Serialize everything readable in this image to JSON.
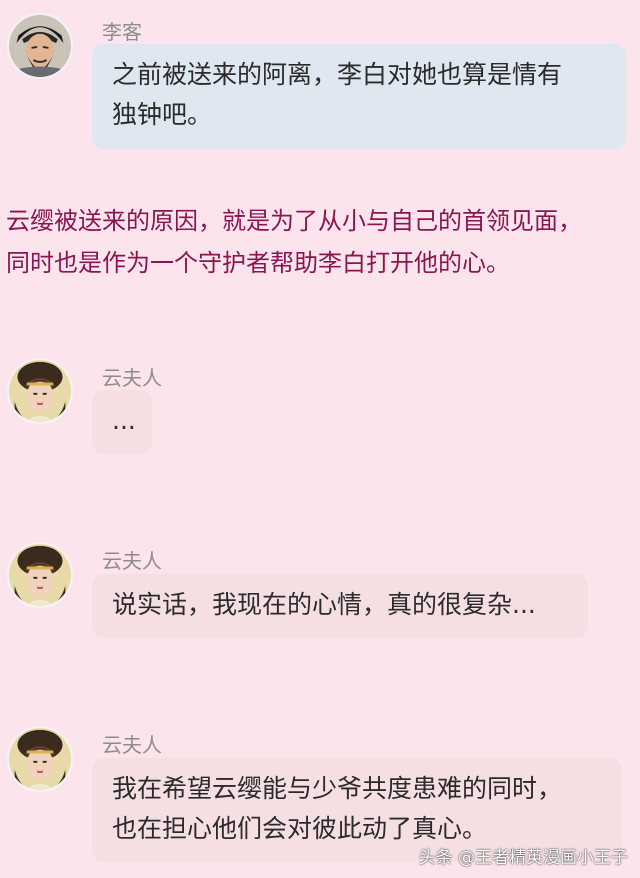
{
  "messages": [
    {
      "sender": "李客",
      "lines": [
        "之前被送来的阿离，李白对她也算是情有",
        "独钟吧。"
      ]
    },
    {
      "sender": "云夫人",
      "lines": [
        "..."
      ]
    },
    {
      "sender": "云夫人",
      "lines": [
        "说实话，我现在的心情，真的很复杂..."
      ]
    },
    {
      "sender": "云夫人",
      "lines": [
        "我在希望云缨能与少爷共度患难的同时，",
        "也在担心他们会对彼此动了真心。"
      ]
    }
  ],
  "narration": {
    "line1": "云缨被送来的原因，就是为了从小与自己的首领见面，",
    "line2": "同时也是作为一个守护者帮助李白打开他的心。"
  },
  "watermark": "头条 @王者精英漫画小王子",
  "colors": {
    "background": "#fce4ec",
    "bubble_blue": "#dfe7f0",
    "bubble_pink": "#f5dfe3",
    "narration_text": "#8a1552",
    "sender_text": "#8d8d8d"
  }
}
